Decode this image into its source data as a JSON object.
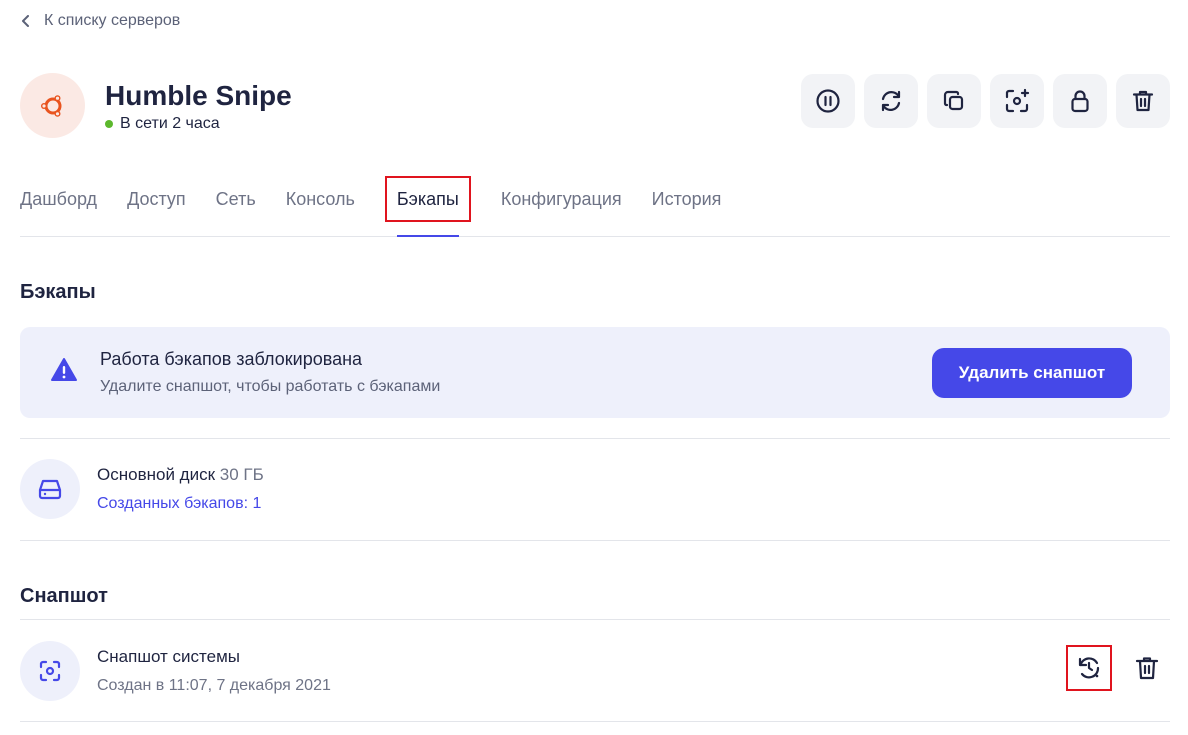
{
  "nav": {
    "back_label": "К списку серверов"
  },
  "server": {
    "name": "Humble Snipe",
    "status": "В сети 2 часа",
    "os_icon": "ubuntu-icon",
    "status_color": "#5cb82d"
  },
  "toolbar": {
    "icons": [
      "pause-icon",
      "reload-icon",
      "copy-icon",
      "snapshot-add-icon",
      "lock-icon",
      "trash-icon"
    ]
  },
  "tabs": [
    {
      "label": "Дашборд"
    },
    {
      "label": "Доступ"
    },
    {
      "label": "Сеть"
    },
    {
      "label": "Консоль"
    },
    {
      "label": "Бэкапы",
      "active": true
    },
    {
      "label": "Конфигурация"
    },
    {
      "label": "История"
    }
  ],
  "backups": {
    "title": "Бэкапы",
    "alert": {
      "title": "Работа бэкапов заблокирована",
      "description": "Удалите снапшот, чтобы работать с бэкапами",
      "button_label": "Удалить снапшот"
    },
    "disk": {
      "name": "Основной диск",
      "size": "30 ГБ",
      "backups_count": "Созданных бэкапов: 1"
    }
  },
  "snapshot": {
    "title": "Снапшот",
    "name": "Снапшот системы",
    "created": "Создан в 11:07, 7 декабря 2021"
  },
  "colors": {
    "accent": "#4548e8",
    "highlight": "#e0141e",
    "ubuntu": "#e9541f"
  }
}
